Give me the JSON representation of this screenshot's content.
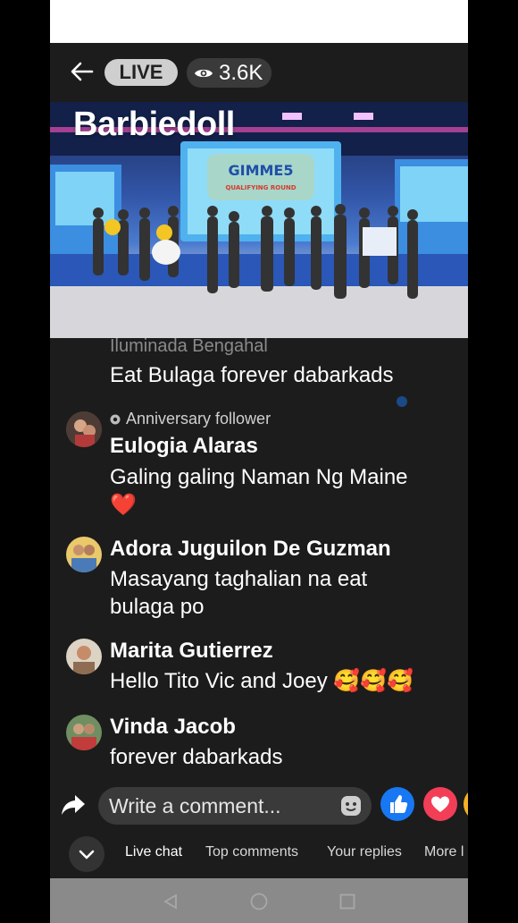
{
  "header": {
    "live_label": "LIVE",
    "viewer_count": "3.6K"
  },
  "video": {
    "stream_title": "Barbiedoll",
    "stage_sign": "GIMME5",
    "stage_subtitle": "QUALIFYING ROUND"
  },
  "chat": {
    "partial_name": "Iluminada Bengahal",
    "first_message": "Eat Bulaga forever dabarkads",
    "messages": [
      {
        "badge": "Anniversary follower",
        "name": "Eulogia Alaras",
        "text": "Galing galing Naman Ng Maine",
        "emoji": "❤️"
      },
      {
        "name": "Adora Juguilon De Guzman",
        "text": "Masayang taghalian na eat bulaga po"
      },
      {
        "name": "Marita Gutierrez",
        "text": "Hello Tito Vic and Joey 🥰🥰🥰"
      },
      {
        "name": "Vinda Jacob",
        "text": "forever dabarkads"
      }
    ]
  },
  "composer": {
    "placeholder": "Write a comment..."
  },
  "tabs": [
    "Live chat",
    "Top comments",
    "Your replies",
    "More l"
  ],
  "colors": {
    "background": "#1c1c1c",
    "like_blue": "#1877f2",
    "love_red": "#f33e58"
  }
}
